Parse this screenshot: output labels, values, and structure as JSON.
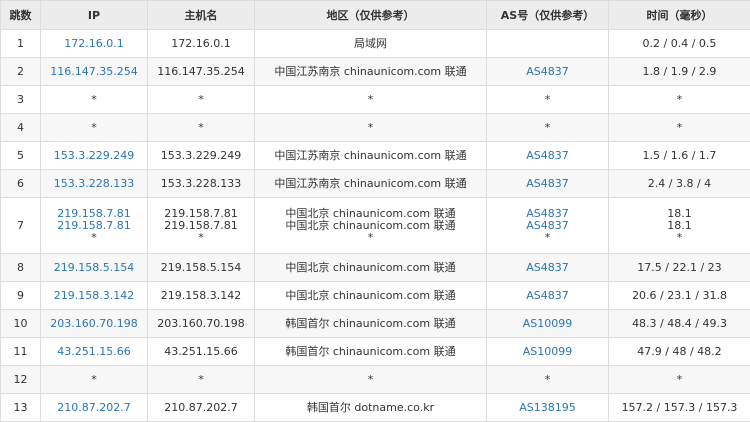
{
  "headers": {
    "hop": "跳数",
    "ip": "IP",
    "host": "主机名",
    "region": "地区（仅供参考）",
    "as": "AS号（仅供参考）",
    "time": "时间（毫秒）"
  },
  "colors": {
    "link": "#2a74b8",
    "header_bg": "#ececec",
    "border": "#dddddd"
  },
  "rows": [
    {
      "hop": "1",
      "ip": [
        "172.16.0.1"
      ],
      "host": [
        "172.16.0.1"
      ],
      "region": [
        "局域网"
      ],
      "as": [
        ""
      ],
      "time": [
        "0.2 / 0.4 / 0.5"
      ]
    },
    {
      "hop": "2",
      "ip": [
        "116.147.35.254"
      ],
      "host": [
        "116.147.35.254"
      ],
      "region": [
        "中国江苏南京 chinaunicom.com 联通"
      ],
      "as": [
        "AS4837"
      ],
      "time": [
        "1.8 / 1.9 / 2.9"
      ]
    },
    {
      "hop": "3",
      "ip": [
        "*"
      ],
      "host": [
        "*"
      ],
      "region": [
        "*"
      ],
      "as": [
        "*"
      ],
      "time": [
        "*"
      ]
    },
    {
      "hop": "4",
      "ip": [
        "*"
      ],
      "host": [
        "*"
      ],
      "region": [
        "*"
      ],
      "as": [
        "*"
      ],
      "time": [
        "*"
      ]
    },
    {
      "hop": "5",
      "ip": [
        "153.3.229.249"
      ],
      "host": [
        "153.3.229.249"
      ],
      "region": [
        "中国江苏南京 chinaunicom.com 联通"
      ],
      "as": [
        "AS4837"
      ],
      "time": [
        "1.5 / 1.6 / 1.7"
      ]
    },
    {
      "hop": "6",
      "ip": [
        "153.3.228.133"
      ],
      "host": [
        "153.3.228.133"
      ],
      "region": [
        "中国江苏南京 chinaunicom.com 联通"
      ],
      "as": [
        "AS4837"
      ],
      "time": [
        "2.4 / 3.8 / 4"
      ]
    },
    {
      "hop": "7",
      "ip": [
        "219.158.7.81",
        "219.158.7.81",
        "*"
      ],
      "host": [
        "219.158.7.81",
        "219.158.7.81",
        "*"
      ],
      "region": [
        "中国北京 chinaunicom.com 联通",
        "中国北京 chinaunicom.com 联通",
        "*"
      ],
      "as": [
        "AS4837",
        "AS4837",
        "*"
      ],
      "time": [
        "18.1",
        "18.1",
        "*"
      ]
    },
    {
      "hop": "8",
      "ip": [
        "219.158.5.154"
      ],
      "host": [
        "219.158.5.154"
      ],
      "region": [
        "中国北京 chinaunicom.com 联通"
      ],
      "as": [
        "AS4837"
      ],
      "time": [
        "17.5 / 22.1 / 23"
      ]
    },
    {
      "hop": "9",
      "ip": [
        "219.158.3.142"
      ],
      "host": [
        "219.158.3.142"
      ],
      "region": [
        "中国北京 chinaunicom.com 联通"
      ],
      "as": [
        "AS4837"
      ],
      "time": [
        "20.6 / 23.1 / 31.8"
      ]
    },
    {
      "hop": "10",
      "ip": [
        "203.160.70.198"
      ],
      "host": [
        "203.160.70.198"
      ],
      "region": [
        "韩国首尔 chinaunicom.com 联通"
      ],
      "as": [
        "AS10099"
      ],
      "time": [
        "48.3 / 48.4 / 49.3"
      ]
    },
    {
      "hop": "11",
      "ip": [
        "43.251.15.66"
      ],
      "host": [
        "43.251.15.66"
      ],
      "region": [
        "韩国首尔 chinaunicom.com 联通"
      ],
      "as": [
        "AS10099"
      ],
      "time": [
        "47.9 / 48 / 48.2"
      ]
    },
    {
      "hop": "12",
      "ip": [
        "*"
      ],
      "host": [
        "*"
      ],
      "region": [
        "*"
      ],
      "as": [
        "*"
      ],
      "time": [
        "*"
      ]
    },
    {
      "hop": "13",
      "ip": [
        "210.87.202.7"
      ],
      "host": [
        "210.87.202.7"
      ],
      "region": [
        "韩国首尔 dotname.co.kr"
      ],
      "as": [
        "AS138195"
      ],
      "time": [
        "157.2 / 157.3 / 157.3"
      ]
    }
  ]
}
